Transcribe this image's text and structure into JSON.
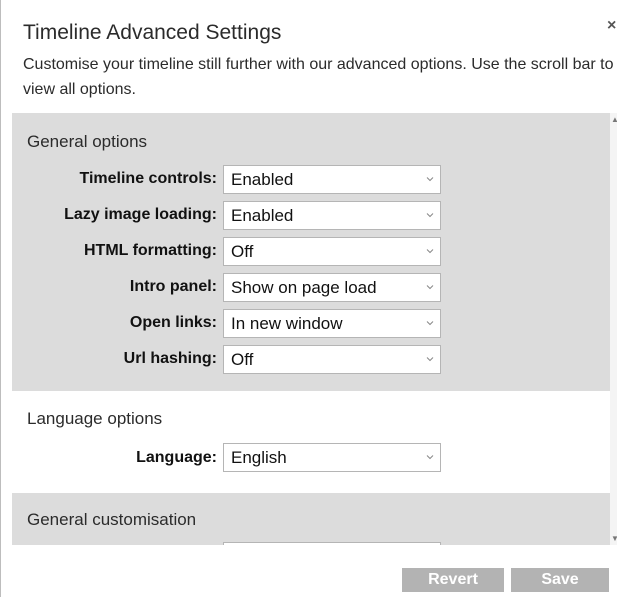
{
  "dialog": {
    "title": "Timeline Advanced Settings",
    "intro": "Customise your timeline still further with our advanced options. Use the scroll bar to view all options.",
    "close_label": "×"
  },
  "general": {
    "title": "General options",
    "rows": [
      {
        "label": "Timeline controls:",
        "value": "Enabled"
      },
      {
        "label": "Lazy image loading:",
        "value": "Enabled"
      },
      {
        "label": "HTML formatting:",
        "value": "Off"
      },
      {
        "label": "Intro panel:",
        "value": "Show on page load"
      },
      {
        "label": "Open links:",
        "value": "In new window"
      },
      {
        "label": "Url hashing:",
        "value": "Off"
      }
    ]
  },
  "language": {
    "title": "Language options",
    "label": "Language:",
    "value": "English"
  },
  "customisation": {
    "title": "General customisation"
  },
  "footer": {
    "revert_label": "Revert",
    "save_label": "Save"
  },
  "icons": {
    "dropdown": "chevron-down-icon",
    "close": "close-icon",
    "scroll_up": "scroll-up-icon",
    "scroll_down": "scroll-down-icon"
  },
  "colors": {
    "section_shade": "#dcdcdc",
    "button_disabled": "#b3b3b3"
  }
}
